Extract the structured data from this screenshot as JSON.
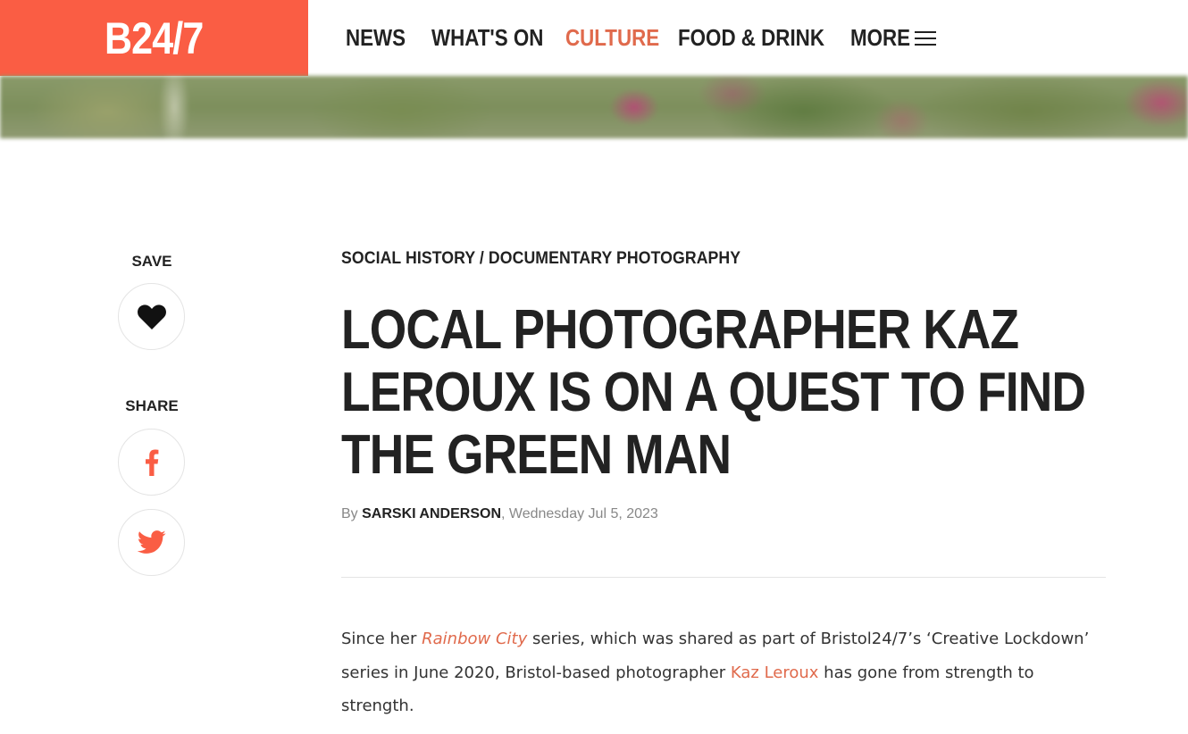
{
  "header": {
    "logo": "B24/7",
    "nav": [
      {
        "label": "NEWS",
        "active": false
      },
      {
        "label": "WHAT'S ON",
        "active": false
      },
      {
        "label": "CULTURE",
        "active": true
      },
      {
        "label": "FOOD & DRINK",
        "active": false
      },
      {
        "label": "MORE",
        "active": false,
        "icon": "menu-icon"
      }
    ],
    "accent_color": "#fa5d44",
    "active_color": "#e06a4c"
  },
  "sidebar": {
    "save_label": "SAVE",
    "save_icon": "heart-icon",
    "share_label": "SHARE",
    "share_icons": [
      "facebook-icon",
      "twitter-icon"
    ]
  },
  "article": {
    "category": "SOCIAL HISTORY / DOCUMENTARY PHOTOGRAPHY",
    "title": "LOCAL PHOTOGRAPHER KAZ LEROUX IS ON A QUEST TO FIND THE GREEN MAN",
    "byline_prefix": "By ",
    "author": "SARSKI ANDERSON",
    "date": ", Wednesday Jul 5, 2023",
    "body": {
      "t1": "Since her ",
      "link1": "Rainbow City",
      "t2": " series, which was shared as part of Bristol24/7’s ‘Creative Lockdown’ series in June 2020, Bristol-based photographer ",
      "link2": "Kaz Leroux",
      "t3": " has gone from strength to strength."
    }
  }
}
